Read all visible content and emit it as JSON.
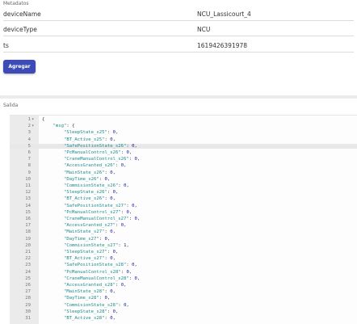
{
  "metadata": {
    "label": "Metadatos",
    "rows": [
      {
        "key": "deviceName",
        "value": "NCU_Lassicourt_4"
      },
      {
        "key": "deviceType",
        "value": "NCU"
      },
      {
        "key": "ts",
        "value": "1619426391978"
      }
    ],
    "add_button": "Agregar"
  },
  "output": {
    "label": "Salida",
    "lines": [
      {
        "n": "1",
        "fold": "▾",
        "code": "{"
      },
      {
        "n": "2",
        "fold": "▾",
        "code": "    \"msg\": {"
      },
      {
        "n": "3",
        "code": "        \"SleepState_s25\": 0,"
      },
      {
        "n": "4",
        "code": "        \"BT_Active_s25\": 0,"
      },
      {
        "n": "5",
        "code": "        \"SafePositionState_s26\": 0,"
      },
      {
        "n": "6",
        "code": "        \"PcManualControl_s26\": 0,"
      },
      {
        "n": "7",
        "code": "        \"CraneManualControl_s26\": 0,"
      },
      {
        "n": "8",
        "code": "        \"AccessGranted_s26\": 0,"
      },
      {
        "n": "9",
        "code": "        \"MainState_s26\": 0,"
      },
      {
        "n": "10",
        "code": "        \"DayTime_s26\": 0,"
      },
      {
        "n": "11",
        "code": "        \"CommisionState_s26\": 0,"
      },
      {
        "n": "12",
        "code": "        \"SleepState_s26\": 0,"
      },
      {
        "n": "13",
        "code": "        \"BT_Active_s26\": 0,"
      },
      {
        "n": "14",
        "code": "        \"SafePositionState_s27\": 0,"
      },
      {
        "n": "15",
        "code": "        \"PcManualControl_s27\": 0,"
      },
      {
        "n": "16",
        "code": "        \"CraneManualControl_s27\": 0,"
      },
      {
        "n": "17",
        "code": "        \"AccessGranted_s27\": 0,"
      },
      {
        "n": "18",
        "code": "        \"MainState_s27\": 0,"
      },
      {
        "n": "19",
        "code": "        \"DayTime_s27\": 0,"
      },
      {
        "n": "20",
        "code": "        \"CommisionState_s27\": 1,"
      },
      {
        "n": "21",
        "code": "        \"SleepState_s27\": 0,"
      },
      {
        "n": "22",
        "code": "        \"BT_Active_s27\": 0,"
      },
      {
        "n": "23",
        "code": "        \"SafePositionState_s28\": 0,"
      },
      {
        "n": "24",
        "code": "        \"PcManualControl_s28\": 0,"
      },
      {
        "n": "25",
        "code": "        \"CraneManualControl_s28\": 0,"
      },
      {
        "n": "26",
        "code": "        \"AccessGranted_s28\": 0,"
      },
      {
        "n": "27",
        "code": "        \"MainState_s28\": 0,"
      },
      {
        "n": "28",
        "code": "        \"DayTime_s28\": 0,"
      },
      {
        "n": "29",
        "code": "        \"CommisionState_s28\": 0,"
      },
      {
        "n": "30",
        "code": "        \"SleepState_s28\": 0,"
      },
      {
        "n": "31",
        "code": "        \"BT_Active_s28\": 0,"
      }
    ]
  }
}
